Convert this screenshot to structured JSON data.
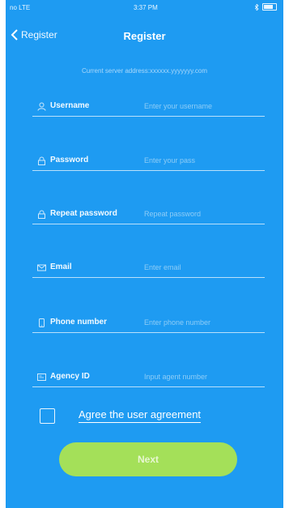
{
  "status_bar": {
    "carrier": "no LTE",
    "time": "3:37 PM"
  },
  "nav": {
    "back_label": "Register",
    "title": "Register"
  },
  "subtitle": "Current server address:xxxxxx.yyyyyyy.com",
  "fields": [
    {
      "label": "Username",
      "placeholder": "Enter your username",
      "icon": "user-icon"
    },
    {
      "label": "Password",
      "placeholder": "Enter your pass",
      "icon": "lock-icon"
    },
    {
      "label": "Repeat password",
      "placeholder": "Repeat password",
      "icon": "lock-icon"
    },
    {
      "label": "Email",
      "placeholder": "Enter email",
      "icon": "mail-icon"
    },
    {
      "label": "Phone number",
      "placeholder": "Enter phone number",
      "icon": "phone-icon"
    },
    {
      "label": "Agency ID",
      "placeholder": "Input agent number",
      "icon": "id-card-icon"
    }
  ],
  "agreement": {
    "label": "Agree the user agreement",
    "checked": false
  },
  "next_button": {
    "label": "Next"
  },
  "colors": {
    "background": "#1e9bf2",
    "button": "#a4e059"
  }
}
